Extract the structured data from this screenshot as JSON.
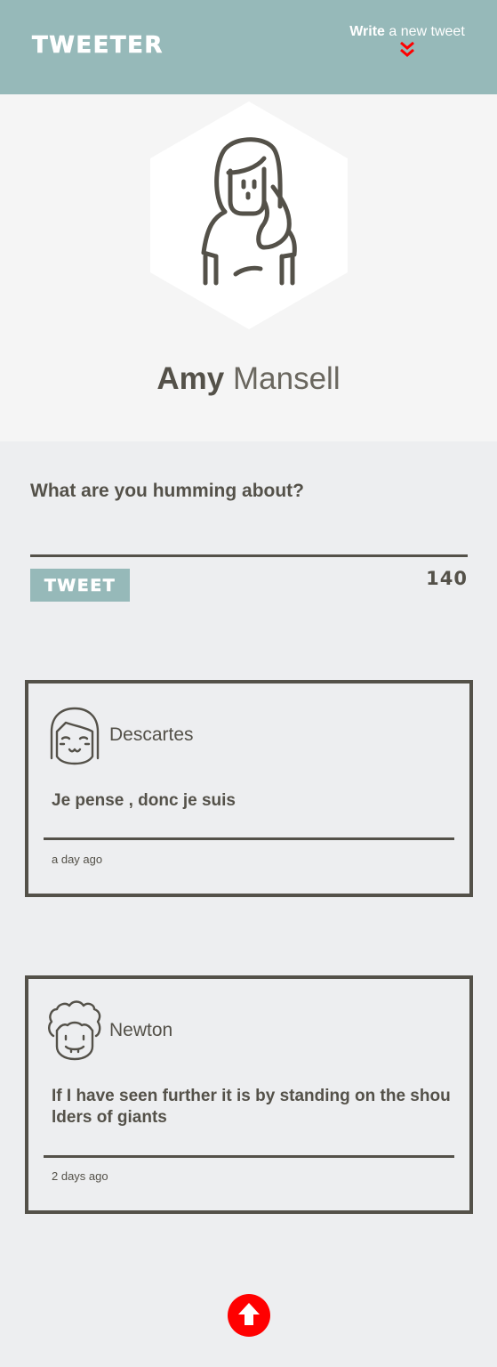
{
  "header": {
    "brand": "TWEETER",
    "compose_bold": "Write",
    "compose_rest": " a new tweet",
    "compose_icon": "chevron-double-down-icon",
    "accent_color": "#96b9b9",
    "arrow_color": "#ff0000"
  },
  "profile": {
    "avatar_icon": "woman-avatar-icon",
    "first_name": "Amy",
    "last_name": "Mansell"
  },
  "composer": {
    "placeholder": "What are you humming about?",
    "value": "",
    "tweet_label": "TWEET",
    "counter": "140"
  },
  "tweets": [
    {
      "avatar_icon": "smiling-girl-avatar-icon",
      "author": "Descartes",
      "text": "Je pense , donc je suis",
      "time": "a day ago"
    },
    {
      "avatar_icon": "curly-hair-man-avatar-icon",
      "author": "Newton",
      "text": "If I have seen further it is by standing on the shoulders of giants",
      "time": "2 days ago"
    }
  ],
  "footer": {
    "scroll_top_icon": "arrow-up-icon"
  },
  "colors": {
    "text": "#545149",
    "page_background": "#edeef0",
    "profile_background": "#f5f5f5"
  }
}
